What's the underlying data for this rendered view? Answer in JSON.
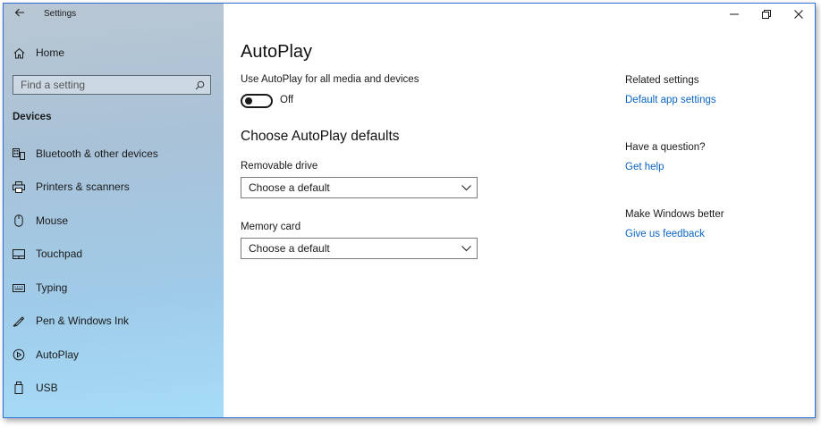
{
  "window": {
    "title": "Settings",
    "caption": {
      "minimize": "–",
      "maximize": "❐",
      "close": "✕"
    }
  },
  "sidebar": {
    "home_label": "Home",
    "search_placeholder": "Find a setting",
    "section_heading": "Devices",
    "items": [
      {
        "label": "Bluetooth & other devices",
        "icon": "bluetooth-devices-icon"
      },
      {
        "label": "Printers & scanners",
        "icon": "printer-icon"
      },
      {
        "label": "Mouse",
        "icon": "mouse-icon"
      },
      {
        "label": "Touchpad",
        "icon": "touchpad-icon"
      },
      {
        "label": "Typing",
        "icon": "keyboard-icon"
      },
      {
        "label": "Pen & Windows Ink",
        "icon": "pen-icon"
      },
      {
        "label": "AutoPlay",
        "icon": "autoplay-icon"
      },
      {
        "label": "USB",
        "icon": "usb-icon"
      }
    ]
  },
  "main": {
    "title": "AutoPlay",
    "toggle_label": "Use AutoPlay for all media and devices",
    "toggle_state": "Off",
    "defaults_title": "Choose AutoPlay defaults",
    "removable_label": "Removable drive",
    "removable_value": "Choose a default",
    "memory_label": "Memory card",
    "memory_value": "Choose a default"
  },
  "aside": {
    "related_heading": "Related settings",
    "related_link": "Default app settings",
    "question_heading": "Have a question?",
    "question_link": "Get help",
    "better_heading": "Make Windows better",
    "better_link": "Give us feedback"
  },
  "colors": {
    "accent": "#0a64c2",
    "window_border": "#2f6fd6"
  }
}
